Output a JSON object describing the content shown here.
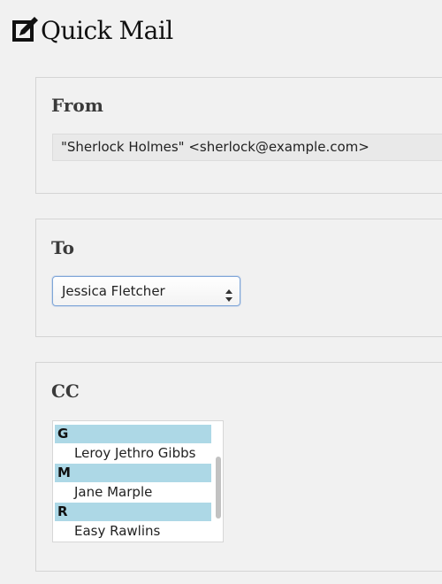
{
  "page": {
    "title": "Quick Mail",
    "icon": "pencil-note-icon"
  },
  "from": {
    "heading": "From",
    "value": "\"Sherlock Holmes\" <sherlock@example.com>"
  },
  "to": {
    "heading": "To",
    "selected": "Jessica Fletcher"
  },
  "cc": {
    "heading": "CC",
    "groups": [
      {
        "label": "G",
        "options": [
          "Leroy Jethro Gibbs"
        ]
      },
      {
        "label": "M",
        "options": [
          "Jane Marple"
        ]
      },
      {
        "label": "R",
        "options": [
          "Easy Rawlins"
        ]
      }
    ]
  }
}
